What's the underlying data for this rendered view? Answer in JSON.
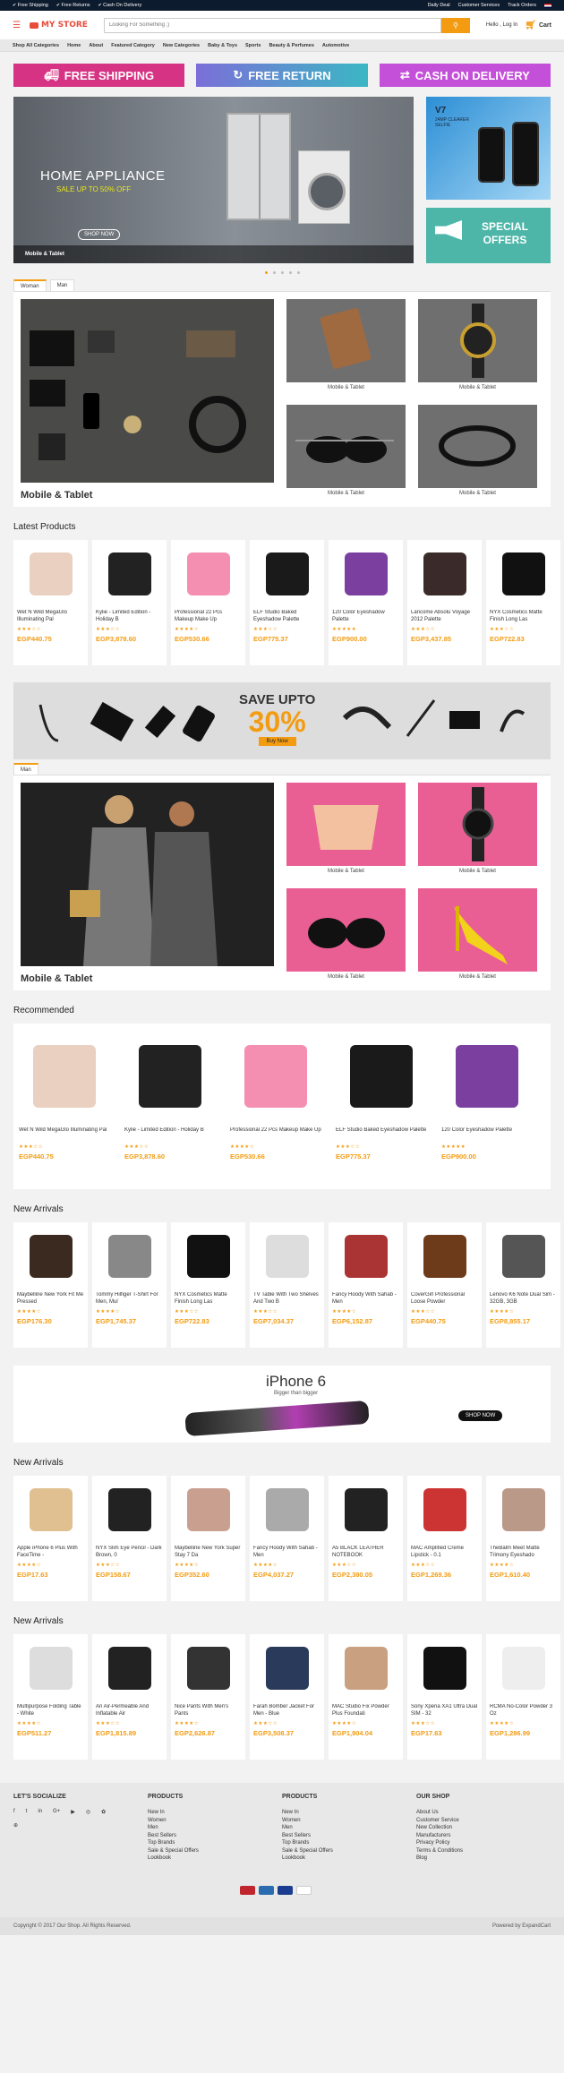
{
  "topbar": {
    "links": [
      "Free Shipping",
      "Free Returns",
      "Cash On Delivery"
    ],
    "right": [
      "Daily Deal",
      "Customer Services",
      "Track Orders"
    ]
  },
  "header": {
    "logo": "MY STORE",
    "search_placeholder": "Looking For Something ;)",
    "login": "Hello , Log In",
    "cart": "Cart"
  },
  "nav": [
    "Shop All Categories",
    "Home",
    "About",
    "Featured Category",
    "New Categories",
    "Baby & Toys",
    "Sports",
    "Beauty & Perfumes",
    "Automotive"
  ],
  "promos": [
    {
      "label": "FREE SHIPPING",
      "color": "#d63384"
    },
    {
      "label": "FREE RETURN",
      "color": "#4aa8d8"
    },
    {
      "label": "CASH ON DELIVERY",
      "color": "#c44fd8"
    }
  ],
  "hero": {
    "title": "HOME APPLIANCE",
    "sub": "SALE UP TO 50% OFF",
    "shop": "SHOP NOW",
    "caption": "Mobile & Tablet",
    "side1_title": "V7",
    "side1_sub": "24MP CLEARER SELFIE",
    "side2_a": "SPECIAL",
    "side2_b": "OFFERS"
  },
  "tabs1": [
    "Woman",
    "Man"
  ],
  "feat1": {
    "title": "Mobile & Tablet",
    "cells": [
      "Mobile & Tablet",
      "Mobile & Tablet",
      "Mobile & Tablet",
      "Mobile & Tablet"
    ]
  },
  "latest": {
    "title": "Latest Products",
    "items": [
      {
        "name": "Wet N Wild MegaGlo Illuminating Pal",
        "stars": "★★★☆☆",
        "price": "EGP440.75",
        "img": "#e9d0c0"
      },
      {
        "name": "Kylie - Limited Edition - Holiday B",
        "stars": "★★★☆☆",
        "price": "EGP3,878.60",
        "img": "#222"
      },
      {
        "name": "Professional 22 Pcs Makeup Make Up",
        "stars": "★★★★☆",
        "price": "EGP530.66",
        "img": "#f48fb1"
      },
      {
        "name": "ELF Studio Baked Eyeshadow Palette",
        "stars": "★★★☆☆",
        "price": "EGP775.37",
        "img": "#1a1a1a"
      },
      {
        "name": "120 Color Eyeshadow Palette",
        "stars": "★★★★★",
        "price": "EGP900.00",
        "img": "#7b3fa0"
      },
      {
        "name": "Lancome Absolu Voyage 2012 Palette",
        "stars": "★★★☆☆",
        "price": "EGP3,437.85",
        "img": "#3a2a2a"
      },
      {
        "name": "NYX Cosmetics Matte Finish Long Las",
        "stars": "★★★☆☆",
        "price": "EGP722.83",
        "img": "#111"
      }
    ]
  },
  "banner": {
    "t1": "SAVE UPTO",
    "t2": "30%",
    "btn": "Buy Now"
  },
  "tabs2": [
    "Man"
  ],
  "feat2": {
    "title": "Mobile & Tablet",
    "cells": [
      "Mobile & Tablet",
      "Mobile & Tablet",
      "Mobile & Tablet",
      "Mobile & Tablet"
    ]
  },
  "recommended": {
    "title": "Recommended",
    "items": [
      {
        "name": "Wet N Wild MegaGlo Illuminating Pal",
        "stars": "★★★☆☆",
        "price": "EGP440.75",
        "img": "#e9d0c0"
      },
      {
        "name": "Kylie - Limited Edition - Holiday B",
        "stars": "★★★☆☆",
        "price": "EGP3,878.60",
        "img": "#222"
      },
      {
        "name": "Professional 22 Pcs Makeup Make Up",
        "stars": "★★★★☆",
        "price": "EGP530.66",
        "img": "#f48fb1"
      },
      {
        "name": "ELF Studio Baked Eyeshadow Palette",
        "stars": "★★★☆☆",
        "price": "EGP775.37",
        "img": "#1a1a1a"
      },
      {
        "name": "120 Color Eyeshadow Palette",
        "stars": "★★★★★",
        "price": "EGP900.00",
        "img": "#7b3fa0"
      }
    ]
  },
  "arrivals1": {
    "title": "New Arrivals",
    "items": [
      {
        "name": "Maybelline New York Fit Me Pressed",
        "stars": "★★★★☆",
        "price": "EGP176.30",
        "img": "#3a2a20"
      },
      {
        "name": "Tommy Hilfiger T-Shirt For Men, Mul",
        "stars": "★★★★☆",
        "price": "EGP1,745.37",
        "img": "#888"
      },
      {
        "name": "NYX Cosmetics Matte Finish Long Las",
        "stars": "★★★☆☆",
        "price": "EGP722.83",
        "img": "#111"
      },
      {
        "name": "TV Table With Two Shelves And Two B",
        "stars": "★★★☆☆",
        "price": "EGP7,034.37",
        "img": "#ddd"
      },
      {
        "name": "Fancy Hoody With Sahab - Men",
        "stars": "★★★★☆",
        "price": "EGP6,152.87",
        "img": "#a33"
      },
      {
        "name": "CoverGirl Professional Loose Powder",
        "stars": "★★★☆☆",
        "price": "EGP440.75",
        "img": "#6d3a1a"
      },
      {
        "name": "Lenovo K6 Note Dual Sim - 32GB, 3GB",
        "stars": "★★★★☆",
        "price": "EGP8,855.17",
        "img": "#555"
      }
    ]
  },
  "iphone": {
    "title": "iPhone 6",
    "sub": "Bigger than bigger",
    "btn": "SHOP NOW"
  },
  "arrivals2": {
    "title": "New Arrivals",
    "items": [
      {
        "name": "Apple iPhone 6 Plus With FaceTime -",
        "stars": "★★★★☆",
        "price": "EGP17.63",
        "img": "#e0c090"
      },
      {
        "name": "NYX Slim Eye Pencil - Dark Brown, 0",
        "stars": "★★★☆☆",
        "price": "EGP158.67",
        "img": "#222"
      },
      {
        "name": "Maybelline New York Super Stay 7 Da",
        "stars": "★★★★☆",
        "price": "EGP352.60",
        "img": "#c9a090"
      },
      {
        "name": "Fancy Hoody With Sahab - Men",
        "stars": "★★★★☆",
        "price": "EGP4,037.27",
        "img": "#aaa"
      },
      {
        "name": "A5 BLACK LEATHER NOTEBOOK",
        "stars": "★★★☆☆",
        "price": "EGP2,380.05",
        "img": "#222"
      },
      {
        "name": "MAC Amplified Creme Lipstick - 0.1",
        "stars": "★★★☆☆",
        "price": "EGP1,269.36",
        "img": "#c33"
      },
      {
        "name": "TheBalm Meet Matte Trimony Eyeshado",
        "stars": "★★★★☆",
        "price": "EGP1,610.40",
        "img": "#b98"
      }
    ]
  },
  "arrivals3": {
    "title": "New Arrivals",
    "items": [
      {
        "name": "Multipurpose Folding Table - White",
        "stars": "★★★★☆",
        "price": "EGP511.27",
        "img": "#ddd"
      },
      {
        "name": "An Air-Permeable And Inflatable Air",
        "stars": "★★★☆☆",
        "price": "EGP1,815.89",
        "img": "#222"
      },
      {
        "name": "Nice Pants With Men's Pants",
        "stars": "★★★★☆",
        "price": "EGP2,626.87",
        "img": "#333"
      },
      {
        "name": "Farah Bomber Jacket For Men - Blue",
        "stars": "★★★☆☆",
        "price": "EGP3,508.37",
        "img": "#2a3a5a"
      },
      {
        "name": "MAC Studio Fix Powder Plus Foundati",
        "stars": "★★★★☆",
        "price": "EGP1,904.04",
        "img": "#c9a080"
      },
      {
        "name": "Sony Xperia XA1 Ultra Dual SIM - 32",
        "stars": "★★★☆☆",
        "price": "EGP17.63",
        "img": "#111"
      },
      {
        "name": "RCMA No-Color Powder 3 Oz",
        "stars": "★★★★☆",
        "price": "EGP1,286.99",
        "img": "#eee"
      }
    ]
  },
  "footer": {
    "social_title": "LET'S SOCIALIZE",
    "social_icons": [
      "f",
      "t",
      "in",
      "G+",
      "▶",
      "◎",
      "✿",
      "⊕"
    ],
    "col2_title": "PRODUCTS",
    "col2": [
      "New In",
      "Women",
      "Men",
      "Best Sellers",
      "Top Brands",
      "Sale & Special Offers",
      "Lookbook"
    ],
    "col3_title": "PRODUCTS",
    "col3": [
      "New In",
      "Women",
      "Men",
      "Best Sellers",
      "Top Brands",
      "Sale & Special Offers",
      "Lookbook"
    ],
    "col4_title": "OUR SHOP",
    "col4": [
      "About Us",
      "Customer Service",
      "New Collection",
      "Manufacturers",
      "Privacy Policy",
      "Terms & Conditions",
      "Blog"
    ],
    "copyright": "Copyright © 2017 Our Shop. All Rights Reserved.",
    "powered": "Powered by ExpandCart"
  }
}
